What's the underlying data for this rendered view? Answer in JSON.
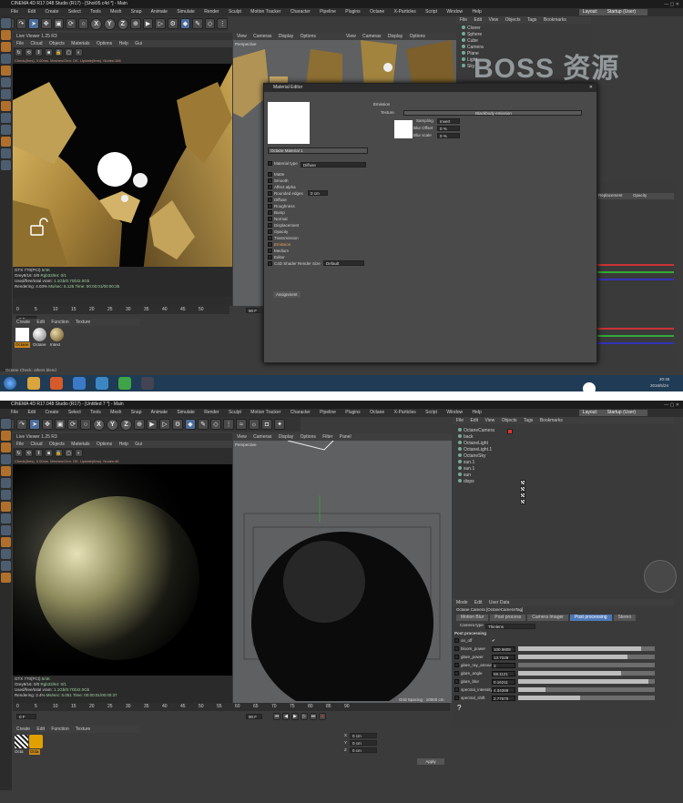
{
  "top": {
    "title": "CINEMA 4D R17.048 Studio (R17) - [Shot05.c4d *] - Main",
    "menu": [
      "File",
      "Edit",
      "Create",
      "Select",
      "Tools",
      "Mesh",
      "Snap",
      "Animate",
      "Simulate",
      "Render",
      "Sculpt",
      "Motion Tracker",
      "Character",
      "Pipeline",
      "Plugins",
      "Octane",
      "X-Particles",
      "Script",
      "Window",
      "Help"
    ],
    "layout_label": "Layout:",
    "layout_value": "Startup (User)",
    "live_viewer_title": "Live Viewer 1.25 R3",
    "live_menu": [
      "File",
      "Cloud",
      "Objects",
      "Materials",
      "Options",
      "Help",
      "Gui"
    ],
    "live_status": "Check(8ms), 0.00ms. Meshes/Gen: OK. Update(8ms). Nodes:166",
    "viewport_menu": [
      "View",
      "Cameras",
      "Display",
      "Options",
      "Filter",
      "Panel"
    ],
    "viewport_label": "Perspective",
    "objects_menu": [
      "File",
      "Edit",
      "View",
      "Objects",
      "Tags",
      "Bookmarks"
    ],
    "objects": [
      "Cloner",
      "Sphere",
      "Cube",
      "Camera",
      "Plane",
      "Light",
      "Sky"
    ],
    "material_editor": {
      "title": "Material Editor",
      "name": "Octane Material 1",
      "material_type_label": "Material type",
      "material_type_value": "Diffuse",
      "channels": [
        "Matte",
        "Smooth",
        "Affect alpha",
        "Rounded edges",
        "Diffuse",
        "Roughness",
        "Bump",
        "Normal",
        "Displacement",
        "Opacity",
        "Transmission",
        "Emission",
        "Medium",
        "Editor",
        "C4D Shader Render Size"
      ],
      "rounded_value": "0 cm",
      "shader_size": "Default",
      "assign_btn": "Assignment",
      "section_title": "Emission",
      "texture_label": "Texture",
      "texture_value": "Blackbody emission",
      "sampling_label": "Sampling",
      "sampling_value": "Invert",
      "blur_offset_label": "Blur Offset",
      "blur_offset_value": "0 %",
      "blur_scale_label": "Blur scale",
      "blur_scale_value": "0 %"
    },
    "stats": [
      {
        "label": "GTX 770(PCI)",
        "value": "5/4K"
      },
      {
        "label": "Grey8/16: 0/0",
        "value": "Rgb32/64: 0/1"
      },
      {
        "label": "Used/free/total vram:",
        "value": "1.1Gb/0.7Gb/2.0Gb"
      },
      {
        "label": "Rendering: 4.03%",
        "value": "Ms/sec: 5.125 Time: 00:00:01/00:00:35"
      }
    ],
    "timeline_ticks": [
      "0",
      "5",
      "10",
      "15",
      "20",
      "25",
      "30",
      "35",
      "40",
      "45",
      "50"
    ],
    "frame_start": "0 F",
    "frame_end": "90 F",
    "mat_menu": [
      "Create",
      "Edit",
      "Function",
      "Texture"
    ],
    "materials": [
      "Octane",
      "Octane",
      "Intext"
    ],
    "status_text": "Octane Check: others blend",
    "clock_time": "20:45",
    "clock_date": "2016/5/24",
    "transform_labels": [
      "X",
      "Y",
      "Z"
    ],
    "attr_tabs": [
      "Basic",
      "Coord.",
      "Replacement",
      "Opacity"
    ]
  },
  "bottom": {
    "title": "CINEMA 4D R17.048 Studio (R17) - [Untitled 7 *] - Main",
    "menu": [
      "File",
      "Edit",
      "Create",
      "Select",
      "Tools",
      "Mesh",
      "Snap",
      "Animate",
      "Simulate",
      "Render",
      "Sculpt",
      "Motion Tracker",
      "Character",
      "Pipeline",
      "Plugins",
      "Octane",
      "X-Particles",
      "Script",
      "Window",
      "Help"
    ],
    "layout_label": "Layout:",
    "layout_value": "Startup (User)",
    "live_viewer_title": "Live Viewer 1.25 R3",
    "live_menu": [
      "File",
      "Cloud",
      "Objects",
      "Materials",
      "Options",
      "Help",
      "Gui"
    ],
    "live_status": "Check(8ms), 0.00ms. Meshes/Gen: OK. Update(8ms). Nodes:46",
    "viewport_menu": [
      "View",
      "Cameras",
      "Display",
      "Options",
      "Filter",
      "Panel"
    ],
    "viewport_label": "Perspective",
    "grid_spacing": "Grid Spacing : 10000 cm",
    "objects_menu": [
      "File",
      "Edit",
      "View",
      "Objects",
      "Tags",
      "Bookmarks"
    ],
    "objects": [
      "OctaneCamera",
      "back",
      "OctaneLight",
      "OctaneLight.1",
      "OctaneSky",
      "sun.1",
      "sun.1",
      "sun",
      "disps"
    ],
    "attr_menu": [
      "Mode",
      "Edit",
      "User Data"
    ],
    "attr_title": "Octane Camera [OctaneCameraTag]",
    "attr_tabs": [
      "Motion Blur",
      "Post process",
      "Camera Imager",
      "Post processing",
      "Stereo"
    ],
    "camera_type_label": "Camera type",
    "camera_type_value": "Thinlens",
    "postproc_header": "Post processing",
    "params": [
      {
        "name": "on_off",
        "value": "",
        "level": 0
      },
      {
        "name": "bloom_power",
        "value": "100.9808",
        "level": 0.9
      },
      {
        "name": "glare_power",
        "value": "13.7249",
        "level": 0.8
      },
      {
        "name": "glare_ray_amount",
        "value": "3",
        "level": 0.0
      },
      {
        "name": "glare_angle",
        "value": "59.1121",
        "level": 0.75
      },
      {
        "name": "glare_blur",
        "value": "0.16211",
        "level": 0.95
      },
      {
        "name": "spectral_intensity",
        "value": "4.34399",
        "level": 0.2
      },
      {
        "name": "spectral_shift",
        "value": "2.77570",
        "level": 0.45
      }
    ],
    "stats": [
      {
        "label": "GTX 770(PCI)",
        "value": "5/4K"
      },
      {
        "label": "Grey8/16: 0/0",
        "value": "Rgb32/64: 0/1"
      },
      {
        "label": "Used/free/total vram:",
        "value": "1.1Gb/0.7Gb/2.0Gb"
      },
      {
        "label": "Rendering: 2.4%",
        "value": "Ms/sec: 5.051 Time: 00:00:01/00:00:37"
      }
    ],
    "timeline_ticks": [
      "0",
      "5",
      "10",
      "15",
      "20",
      "25",
      "30",
      "35",
      "40",
      "45",
      "50",
      "55",
      "60",
      "65",
      "70",
      "75",
      "80",
      "85",
      "90"
    ],
    "frame_start": "0 F",
    "frame_end": "90 F",
    "mat_menu": [
      "Create",
      "Edit",
      "Function",
      "Texture"
    ],
    "materials": [
      "Octa",
      "Octa"
    ],
    "apply_btn": "Apply",
    "transform_labels": [
      "X",
      "Y",
      "Z"
    ],
    "transform_vals": [
      "0 cm",
      "0 cm",
      "0 cm"
    ]
  },
  "watermark": "BOSS 资源"
}
